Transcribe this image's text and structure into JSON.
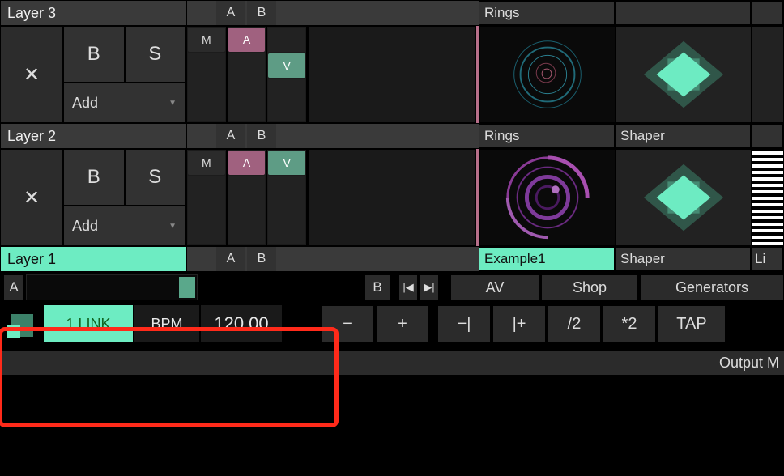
{
  "layers": [
    {
      "title": "Layer 3",
      "active": false,
      "close": "✕",
      "b": "B",
      "s": "S",
      "add": "Add",
      "colA": "A",
      "colB": "B",
      "mav": {
        "m": "M",
        "a": "A",
        "v": "V",
        "vOnB": true
      },
      "clips": [
        {
          "header": "Rings",
          "type": "rings",
          "active": false
        },
        {
          "header": "",
          "type": "shaper",
          "active": false
        }
      ]
    },
    {
      "title": "Layer 2",
      "active": false,
      "close": "✕",
      "b": "B",
      "s": "S",
      "add": "Add",
      "colA": "A",
      "colB": "B",
      "mav": {
        "m": "M",
        "a": "A",
        "v": "V",
        "vOnB": false
      },
      "clips": [
        {
          "header": "Rings",
          "type": "rings2",
          "active": false
        },
        {
          "header": "Shaper",
          "type": "shaper",
          "active": false
        },
        {
          "header": "",
          "type": "stripes",
          "active": false
        }
      ]
    }
  ],
  "layer1": {
    "title": "Layer 1",
    "colA": "A",
    "colB": "B",
    "clips": [
      {
        "header": "Example1",
        "active": true
      },
      {
        "header": "Shaper",
        "active": false
      },
      {
        "header": "Li",
        "active": false
      }
    ]
  },
  "transport": {
    "a": "A",
    "b": "B",
    "nav_prev": "◀",
    "nav_next": "▶",
    "cats": [
      "AV",
      "Shop",
      "Generators"
    ],
    "link": "1 LINK",
    "bpm_label": "BPM",
    "bpm_value": "120.00",
    "minus": "−",
    "plus": "+",
    "minus_bar": "−|",
    "plus_bar": "|+",
    "half": "/2",
    "double": "*2",
    "tap": "TAP"
  },
  "output": "Output M",
  "colors": {
    "mint": "#6decc2",
    "pink": "#b76f8a"
  }
}
